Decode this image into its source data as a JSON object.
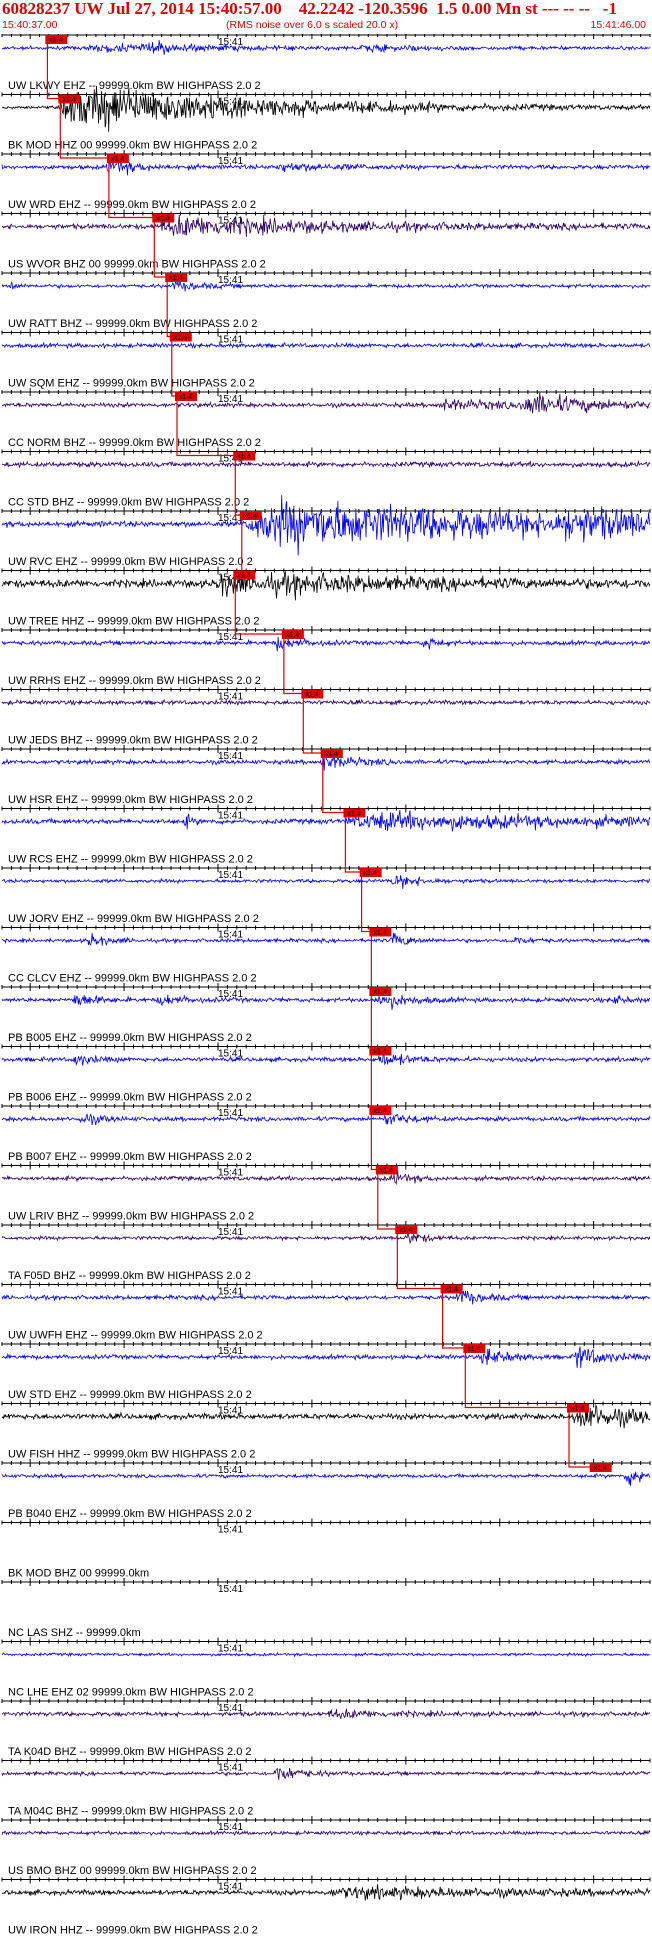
{
  "header": {
    "title": "60828237 UW Jul 27, 2014 15:40:57.00    42.2242 -120.3596  1.5 0.00 Mn st --- -- --   -1",
    "start_time": "15:40:37.00",
    "note": "(RMS noise over 6.0 s scaled 20.0 x)",
    "end_time": "15:41:46.00"
  },
  "colors": {
    "header": "#e00000",
    "pick": "#e00000",
    "blue": "#0000ff",
    "black": "#000000",
    "purple": "#2b0066"
  },
  "chart_data": {
    "type": "line",
    "title": "60828237 UW Jul 27, 2014 15:40:57.00    42.2242 -120.3596  1.5 0.00 Mn st --- -- --   -1",
    "x_range": [
      "15:40:37.00",
      "15:41:46.00"
    ],
    "tick_label": "15:41",
    "pick_label": "x1.4",
    "grid": false,
    "series": [
      {
        "name": "UW LKWY EHZ -- 99999.0km BW  HIGHPASS  2.0  2",
        "color": "blue",
        "amp": 0.25,
        "pick": 0.07,
        "event": [
          [
            0.13,
            0.2,
            0.5
          ],
          [
            0.22,
            0.06,
            0.6
          ],
          [
            0.55,
            0.1,
            0.4
          ]
        ]
      },
      {
        "name": "BK MOD HHZ 00 99999.0km BW  HIGHPASS  2.0  2",
        "color": "black",
        "amp": 0.2,
        "pick": 0.09,
        "event": [
          [
            0.09,
            0.32,
            4.0
          ]
        ]
      },
      {
        "name": "UW WRD EHZ -- 99999.0km BW  HIGHPASS  2.0  2",
        "color": "blue",
        "amp": 0.3,
        "pick": 0.165,
        "event": [
          [
            0.16,
            0.05,
            1.3
          ],
          [
            0.42,
            0.1,
            0.6
          ]
        ]
      },
      {
        "name": "US WVOR BHZ 00 99999.0km BW  HIGHPASS  2.0  2",
        "color": "purple",
        "amp": 0.35,
        "pick": 0.235,
        "event": [
          [
            0.24,
            0.28,
            1.6
          ]
        ]
      },
      {
        "name": "UW RATT BHZ -- 99999.0km BW  HIGHPASS  2.0  2",
        "color": "blue",
        "amp": 0.25,
        "pick": 0.255,
        "event": [
          [
            0.01,
            0.01,
            1.2
          ],
          [
            0.26,
            0.05,
            0.7
          ]
        ]
      },
      {
        "name": "UW SQM EHZ -- 99999.0km BW  HIGHPASS  2.0  2",
        "color": "blue",
        "amp": 0.3,
        "pick": 0.262,
        "event": []
      },
      {
        "name": "CC NORM BHZ -- 99999.0km BW  HIGHPASS  2.0  2",
        "color": "purple",
        "amp": 0.3,
        "pick": 0.27,
        "event": [
          [
            0.67,
            0.12,
            0.8
          ],
          [
            0.8,
            0.12,
            1.6
          ]
        ]
      },
      {
        "name": "CC STD BHZ -- 99999.0km BW  HIGHPASS  2.0  2",
        "color": "purple",
        "amp": 0.35,
        "pick": 0.36,
        "event": []
      },
      {
        "name": "UW RVC EHZ -- 99999.0km BW  HIGHPASS  2.0  2",
        "color": "blue",
        "amp": 0.4,
        "pick": 0.37,
        "event": [
          [
            0.375,
            0.5,
            4.0
          ],
          [
            0.86,
            0.14,
            1.6
          ]
        ]
      },
      {
        "name": "UW TREE HHZ -- 99999.0km BW  HIGHPASS  2.0  2",
        "color": "black",
        "amp": 0.55,
        "pick": 0.36,
        "event": [
          [
            0.33,
            0.1,
            1.6
          ],
          [
            0.4,
            0.4,
            0.9
          ]
        ]
      },
      {
        "name": "UW RRHS EHZ -- 99999.0km BW  HIGHPASS  2.0  2",
        "color": "blue",
        "amp": 0.3,
        "pick": 0.435,
        "event": [
          [
            0.42,
            0.04,
            1.0
          ],
          [
            0.65,
            0.02,
            1.2
          ]
        ]
      },
      {
        "name": "UW JEDS BHZ -- 99999.0km BW  HIGHPASS  2.0  2",
        "color": "purple",
        "amp": 0.3,
        "pick": 0.465,
        "event": []
      },
      {
        "name": "UW HSR EHZ -- 99999.0km BW  HIGHPASS  2.0  2",
        "color": "blue",
        "amp": 0.3,
        "pick": 0.495,
        "event": [
          [
            0.49,
            0.05,
            1.4
          ]
        ]
      },
      {
        "name": "UW RCS EHZ -- 99999.0km BW  HIGHPASS  2.0  2",
        "color": "blue",
        "amp": 0.35,
        "pick": 0.53,
        "event": [
          [
            0.28,
            0.01,
            1.4
          ],
          [
            0.53,
            0.45,
            1.3
          ]
        ]
      },
      {
        "name": "UW JORV EHZ -- 99999.0km BW  HIGHPASS  2.0  2",
        "color": "blue",
        "amp": 0.25,
        "pick": 0.555,
        "event": [
          [
            0.6,
            0.05,
            1.0
          ]
        ]
      },
      {
        "name": "CC CLCV EHZ -- 99999.0km BW  HIGHPASS  2.0  2",
        "color": "blue",
        "amp": 0.25,
        "pick": 0.57,
        "event": [
          [
            0.13,
            0.03,
            1.2
          ],
          [
            0.6,
            0.03,
            1.2
          ],
          [
            0.78,
            0.03,
            0.8
          ]
        ]
      },
      {
        "name": "PB B005 EHZ -- 99999.0km BW  HIGHPASS  2.0  2",
        "color": "blue",
        "amp": 0.3,
        "pick": 0.57,
        "event": [
          [
            0.11,
            0.03,
            1.3
          ],
          [
            0.24,
            0.04,
            0.8
          ],
          [
            0.58,
            0.05,
            1.3
          ],
          [
            0.94,
            0.02,
            0.8
          ]
        ]
      },
      {
        "name": "PB B006 EHZ -- 99999.0km BW  HIGHPASS  2.0  2",
        "color": "blue",
        "amp": 0.3,
        "pick": 0.57,
        "event": [
          [
            0.11,
            0.03,
            1.0
          ],
          [
            0.58,
            0.05,
            1.1
          ]
        ]
      },
      {
        "name": "PB B007 EHZ -- 99999.0km BW  HIGHPASS  2.0  2",
        "color": "blue",
        "amp": 0.3,
        "pick": 0.57,
        "event": [
          [
            0.12,
            0.03,
            1.0
          ],
          [
            0.59,
            0.04,
            1.0
          ]
        ]
      },
      {
        "name": "UW LRIV BHZ -- 99999.0km BW  HIGHPASS  2.0  2",
        "color": "purple",
        "amp": 0.3,
        "pick": 0.58,
        "event": [
          [
            0.6,
            0.03,
            1.0
          ]
        ]
      },
      {
        "name": "TA F05D BHZ -- 99999.0km BW  HIGHPASS  2.0  2",
        "color": "purple",
        "amp": 0.25,
        "pick": 0.61,
        "event": [
          [
            0.62,
            0.03,
            1.2
          ]
        ]
      },
      {
        "name": "UW UWFH EHZ -- 99999.0km BW  HIGHPASS  2.0  2",
        "color": "blue",
        "amp": 0.3,
        "pick": 0.68,
        "event": [
          [
            0.7,
            0.04,
            1.2
          ]
        ]
      },
      {
        "name": "UW STD EHZ -- 99999.0km BW  HIGHPASS  2.0  2",
        "color": "blue",
        "amp": 0.3,
        "pick": 0.715,
        "event": [
          [
            0.74,
            0.04,
            1.5
          ],
          [
            0.88,
            0.05,
            1.9
          ]
        ]
      },
      {
        "name": "UW FISH HHZ -- 99999.0km BW  HIGHPASS  2.0  2",
        "color": "black",
        "amp": 0.4,
        "pick": 0.875,
        "event": [
          [
            0.88,
            0.12,
            2.0
          ]
        ]
      },
      {
        "name": "PB B040 EHZ -- 99999.0km BW  HIGHPASS  2.0  2",
        "color": "blue",
        "amp": 0.25,
        "pick": 0.91,
        "event": [
          [
            0.96,
            0.05,
            1.5
          ]
        ]
      },
      {
        "name": "BK MOD BHZ 00 99999.0km",
        "color": "blue",
        "amp": 0,
        "pick": null,
        "event": []
      },
      {
        "name": "NC LAS SHZ -- 99999.0km",
        "color": "blue",
        "amp": 0,
        "pick": null,
        "event": []
      },
      {
        "name": "NC LHE EHZ 02 99999.0km BW  HIGHPASS  2.0  2",
        "color": "blue",
        "amp": 0.2,
        "pick": null,
        "event": []
      },
      {
        "name": "TA K04D BHZ -- 99999.0km BW  HIGHPASS  2.0  2",
        "color": "purple",
        "amp": 0.3,
        "pick": null,
        "event": [
          [
            0.5,
            0.1,
            0.6
          ]
        ]
      },
      {
        "name": "TA M04C BHZ -- 99999.0km BW  HIGHPASS  2.0  2",
        "color": "purple",
        "amp": 0.25,
        "pick": null,
        "event": [
          [
            0.42,
            0.04,
            1.4
          ]
        ]
      },
      {
        "name": "US BMO BHZ 00 99999.0km BW  HIGHPASS  2.0  2",
        "color": "purple",
        "amp": 0.25,
        "pick": null,
        "event": []
      },
      {
        "name": "UW IRON HHZ -- 99999.0km BW  HIGHPASS  2.0  2",
        "color": "black",
        "amp": 0.35,
        "pick": null,
        "event": [
          [
            0.5,
            0.35,
            0.8
          ]
        ]
      }
    ]
  }
}
